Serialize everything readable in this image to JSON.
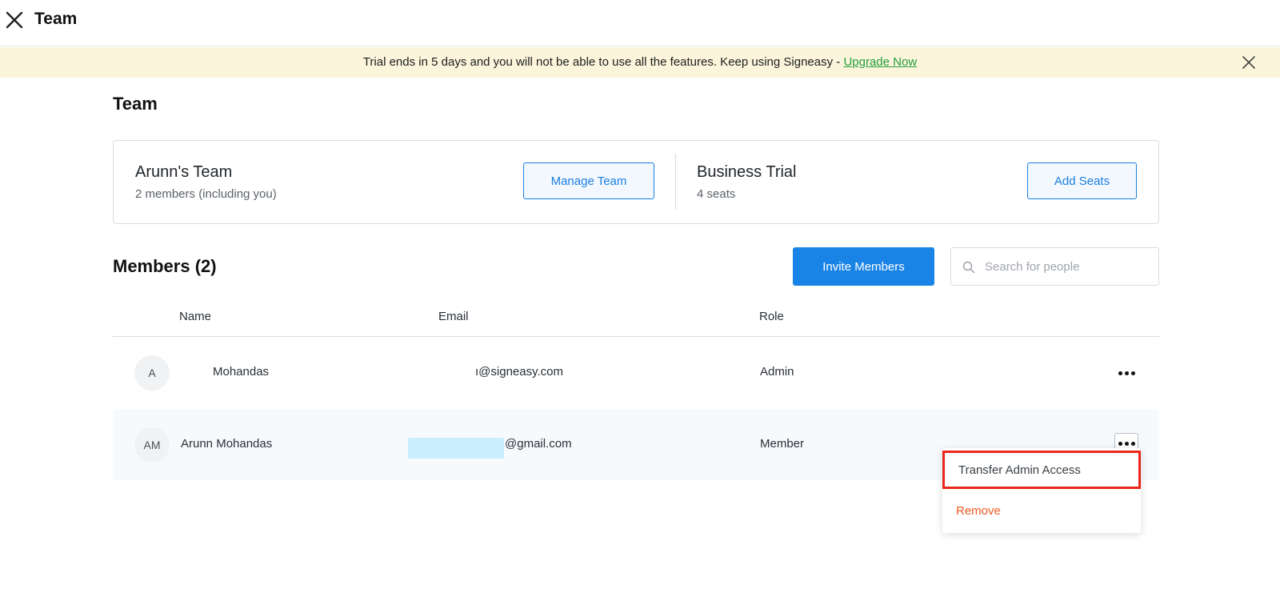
{
  "topbar": {
    "title": "Team",
    "close_icon": "close-icon"
  },
  "banner": {
    "text": "Trial ends in 5 days and you will not be able to use all the features. Keep using Signeasy - ",
    "link": "Upgrade Now",
    "bg_color": "#fcf5dc",
    "link_color": "#1f9d3a"
  },
  "page": {
    "section_title": "Team"
  },
  "team_card": {
    "team_name": "Arunn's Team",
    "team_sub": "2 members (including you)",
    "manage_button": "Manage Team",
    "plan_name": "Business Trial",
    "plan_sub": "4 seats",
    "add_seats_button": "Add Seats"
  },
  "members": {
    "title": "Members (2)",
    "invite_button": "Invite Members",
    "search_placeholder": "Search for people",
    "columns": [
      "Name",
      "Email",
      "Role"
    ],
    "rows": [
      {
        "avatar": "A",
        "name": "Mohandas",
        "email": "ı@signeasy.com",
        "role": "Admin"
      },
      {
        "avatar": "AM",
        "name": "Arunn Mohandas",
        "email": "@gmail.com",
        "role": "Member"
      }
    ]
  },
  "context_menu": {
    "items": [
      "Transfer Admin Access",
      "Remove"
    ],
    "highlight_color": "#e8261c",
    "danger_color": "#f05a22"
  },
  "colors": {
    "primary": "#1a84e6",
    "outline": "#1a7fe0"
  }
}
